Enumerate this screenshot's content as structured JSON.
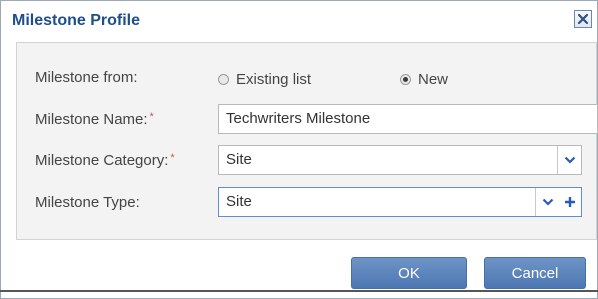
{
  "dialog": {
    "title": "Milestone Profile"
  },
  "form": {
    "source": {
      "label": "Milestone from:",
      "options": [
        {
          "label": "Existing list",
          "checked": false
        },
        {
          "label": "New",
          "checked": true
        }
      ]
    },
    "name": {
      "label": "Milestone Name:",
      "required_mark": "*",
      "value": "Techwriters Milestone"
    },
    "category": {
      "label": "Milestone Category:",
      "required_mark": "*",
      "value": "Site"
    },
    "type": {
      "label": "Milestone Type:",
      "value": "Site"
    }
  },
  "buttons": {
    "ok": "OK",
    "cancel": "Cancel"
  },
  "icons": {
    "close": "close-icon",
    "dropdown": "chevron-down-icon",
    "add": "plus-icon"
  },
  "colors": {
    "title": "#1f4e8c",
    "required": "#d9534f",
    "button": "#5a82ba",
    "focus_border": "#5b8ed6"
  }
}
